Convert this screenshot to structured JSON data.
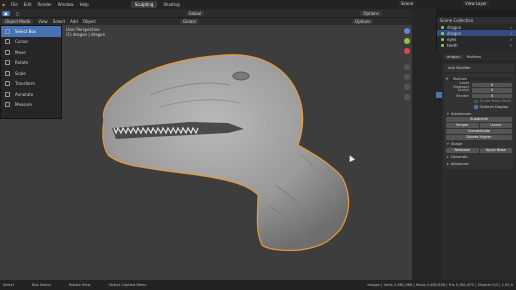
{
  "topbar": {
    "menus": [
      "File",
      "Edit",
      "Render",
      "Window",
      "Help"
    ],
    "workspaces": [
      "Sculpting",
      "Shading"
    ],
    "scene_label": "Scene",
    "view_layer": "View Layer"
  },
  "tool_header": {
    "items": [
      "Global",
      "Options"
    ]
  },
  "viewport_header": {
    "mode": "Object Mode",
    "menus": [
      "View",
      "Select",
      "Add",
      "Object"
    ],
    "orientation": "Global",
    "options": "Options"
  },
  "viewport": {
    "view_name": "User Perspective",
    "object_path": "(1) dragon | dragon"
  },
  "tool_menu": {
    "items": [
      {
        "label": "Select Box",
        "icon": "select-box-icon",
        "active": true
      },
      {
        "label": "Cursor",
        "icon": "cursor-icon",
        "active": false
      },
      {
        "label": "Move",
        "icon": "move-icon",
        "active": false
      },
      {
        "label": "Rotate",
        "icon": "rotate-icon",
        "active": false
      },
      {
        "label": "Scale",
        "icon": "scale-icon",
        "active": false
      },
      {
        "label": "Transform",
        "icon": "transform-icon",
        "active": false
      },
      {
        "label": "Annotate",
        "icon": "annotate-icon",
        "active": false
      },
      {
        "label": "Measure",
        "icon": "measure-icon",
        "active": false
      }
    ]
  },
  "outliner": {
    "header": "Scene Collection",
    "rows": [
      {
        "label": "dragon",
        "selected": false
      },
      {
        "label": "dragon",
        "selected": true
      },
      {
        "label": "eyes",
        "selected": false
      },
      {
        "label": "teeth",
        "selected": false
      }
    ]
  },
  "properties": {
    "object_name": "dragon",
    "modifier_name_tab": "Multires",
    "add_modifier": "Add Modifier",
    "modifier": {
      "name": "Multires",
      "levels": [
        {
          "label": "Level Viewport",
          "value": "4"
        },
        {
          "label": "Sculpt",
          "value": "4"
        },
        {
          "label": "Render",
          "value": "4"
        }
      ],
      "sculpt_base_mesh": "Sculpt Base Mesh",
      "optimal_display": "Optimal Display",
      "subdivision_section": "Subdivision",
      "subdivide": "Subdivide",
      "simple": "Simple",
      "linear": "Linear",
      "unsubdivide": "Unsubdivide",
      "delete_higher": "Delete Higher",
      "shape_section": "Shape",
      "reshape": "Reshape",
      "apply_base": "Apply Base",
      "generate_section": "Generate",
      "advanced_section": "Advanced"
    }
  },
  "statusbar": {
    "select": "Select",
    "box_select": "Box Select",
    "rotate_view": "Rotate View",
    "context_menu": "Object Context Menu",
    "stats": "dragon | Verts 2,681,988 | Faces 2,680,836 | Tris 5,361,672 | Objects 0/3 | 2.92.0"
  },
  "colors": {
    "accent": "#4772b3",
    "selection_outline": "#e89a32",
    "viewport_bg": "#3d3d3d",
    "mesh": "#a8a8a8"
  }
}
